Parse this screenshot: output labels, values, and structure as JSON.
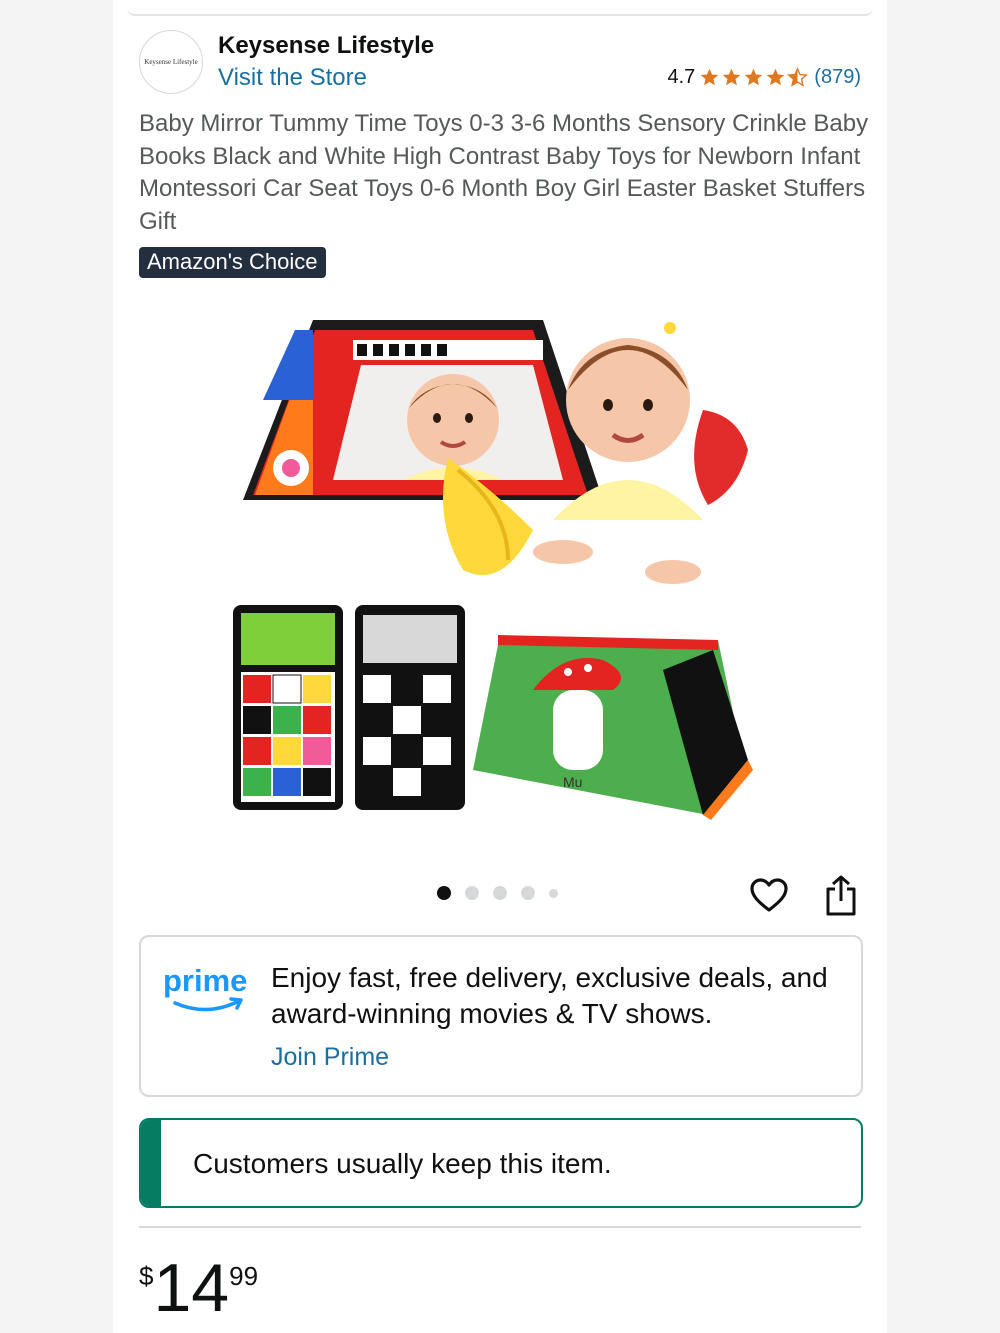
{
  "seller": {
    "logo_text": "Keysense Lifestyle",
    "name": "Keysense Lifestyle",
    "store_link": "Visit the Store"
  },
  "rating": {
    "value": "4.7",
    "stars": 4.7,
    "count": "(879)"
  },
  "product": {
    "title": "Baby Mirror Tummy Time Toys 0-3 3-6 Months Sensory Crinkle Baby Books Black and White High Contrast Baby Toys for Newborn Infant Montessori Car Seat Toys 0-6 Month Boy Girl Easter Basket Stuffers Gift",
    "badge": "Amazon's Choice",
    "image_text": "Mu"
  },
  "gallery": {
    "dot_count": 5,
    "active_index": 0
  },
  "icons": {
    "favorite": "heart-icon",
    "share": "share-icon",
    "star": "star-icon"
  },
  "prime": {
    "logo": "prime",
    "message": "Enjoy fast, free delivery, exclusive deals, and award-winning movies & TV shows.",
    "cta": "Join Prime"
  },
  "return_note": {
    "text": "Customers usually keep this item."
  },
  "price": {
    "symbol": "$",
    "whole": "14",
    "fraction": "99"
  },
  "colors": {
    "link": "#1a6fa0",
    "star": "#de7921",
    "badge_bg": "#232f3e",
    "keep_accent": "#067d62",
    "prime_blue": "#1a98ff"
  }
}
